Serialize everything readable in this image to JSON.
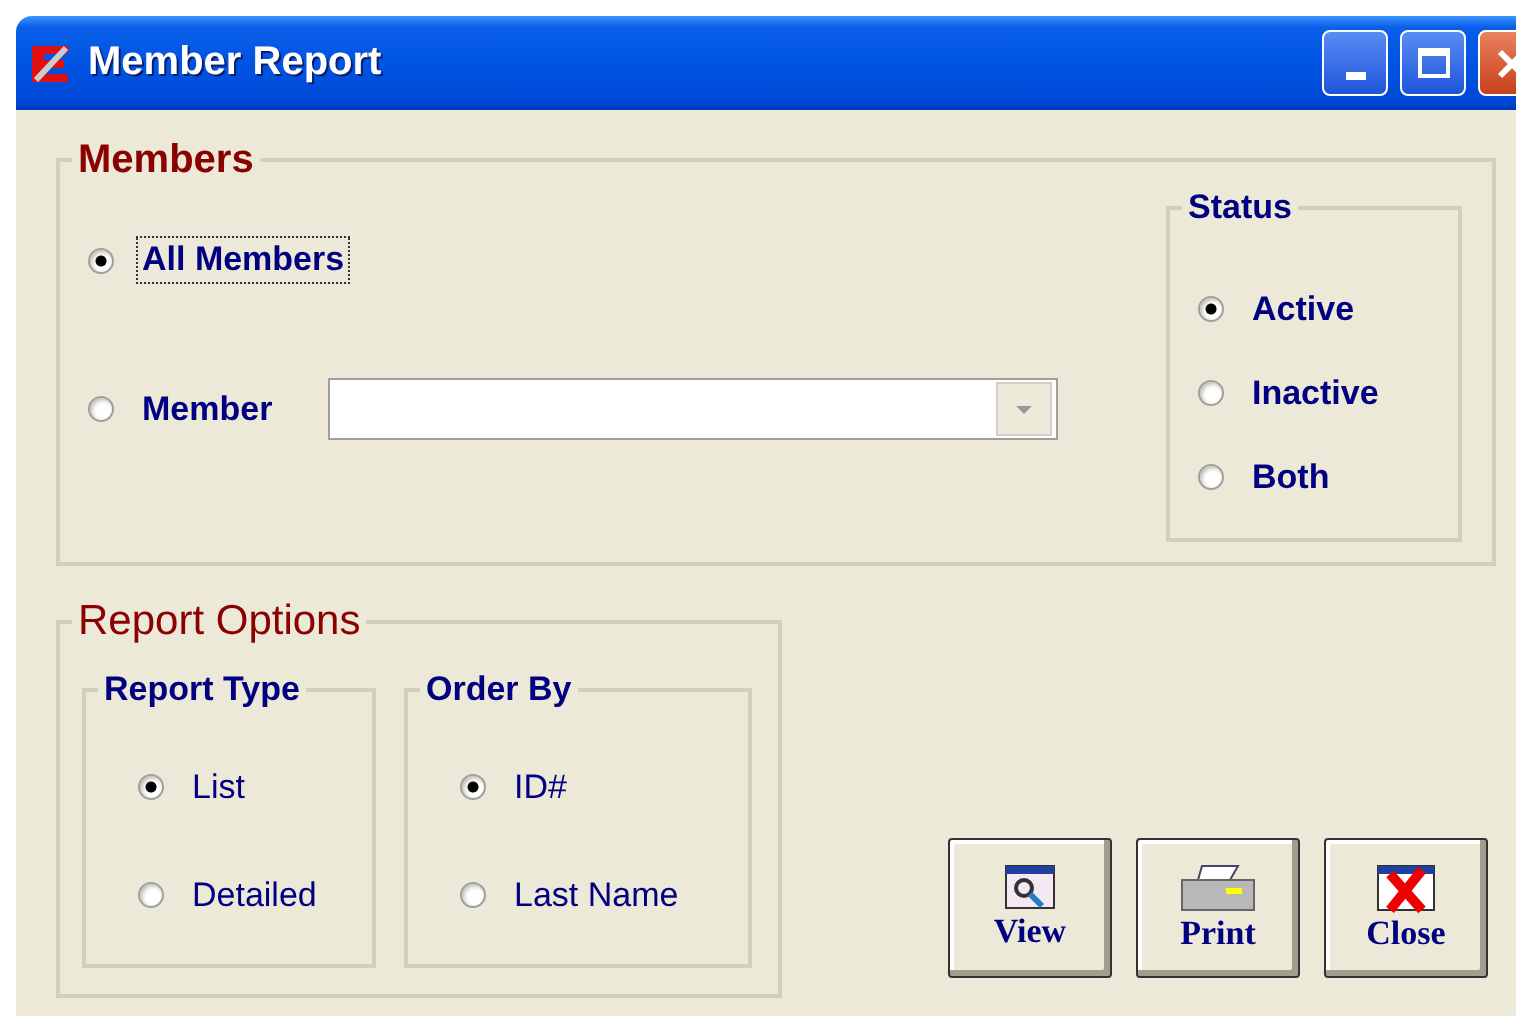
{
  "window": {
    "title": "Member Report"
  },
  "members": {
    "title": "Members",
    "options": [
      {
        "label": "All Members",
        "selected": true,
        "focused": true
      },
      {
        "label": "Member",
        "selected": false,
        "focused": false
      }
    ],
    "status": {
      "title": "Status",
      "options": [
        {
          "label": "Active",
          "selected": true
        },
        {
          "label": "Inactive",
          "selected": false
        },
        {
          "label": "Both",
          "selected": false
        }
      ]
    }
  },
  "report_options": {
    "title": "Report Options",
    "groups": [
      {
        "title": "Report Type",
        "options": [
          {
            "label": "List",
            "selected": true
          },
          {
            "label": "Detailed",
            "selected": false
          }
        ]
      },
      {
        "title": "Order By",
        "options": [
          {
            "label": "ID#",
            "selected": true
          },
          {
            "label": "Last Name",
            "selected": false
          }
        ]
      }
    ]
  },
  "buttons": [
    {
      "label": "View",
      "kind": "view"
    },
    {
      "label": "Print",
      "kind": "print"
    },
    {
      "label": "Close",
      "kind": "close"
    }
  ]
}
